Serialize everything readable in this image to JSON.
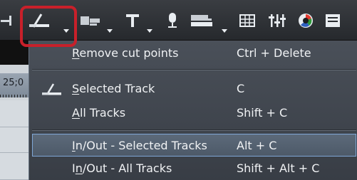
{
  "toolbar": {
    "items": [
      {
        "icon": "partial-icon"
      },
      {
        "icon": "add-cut-point-icon",
        "has_dropdown": true
      },
      {
        "icon": "video-layout-icon",
        "has_dropdown": true
      },
      {
        "icon": "title-icon",
        "has_dropdown": true
      },
      {
        "icon": "microphone-icon"
      },
      {
        "icon": "transfer-icon",
        "has_dropdown": true
      },
      {
        "icon": "grid-icon"
      },
      {
        "icon": "audio-mixer-icon"
      },
      {
        "icon": "color-correction-icon"
      },
      {
        "icon": "panel-icon"
      }
    ],
    "highlight_color": "#c8202a"
  },
  "timeline": {
    "timecode_fragment": "25;0"
  },
  "menu": {
    "items": [
      {
        "pre": "",
        "mnemonic": "R",
        "post": "emove cut points",
        "shortcut": "Ctrl + Delete",
        "icon": ""
      },
      {
        "pre": "",
        "mnemonic": "S",
        "post": "elected Track",
        "shortcut": "C",
        "icon": "add-cut-point-icon"
      },
      {
        "pre": "",
        "mnemonic": "A",
        "post": "ll Tracks",
        "shortcut": "Shift + C",
        "icon": ""
      },
      {
        "pre": "",
        "mnemonic": "I",
        "post": "n/Out - Selected Tracks",
        "shortcut": "Alt + C",
        "icon": "",
        "highlighted": true
      },
      {
        "pre": "I",
        "mnemonic": "n",
        "post": "/Out - All Tracks",
        "shortcut": "Shift + Alt + C",
        "icon": ""
      }
    ]
  },
  "colors": {
    "menu_bg": "#3f444c",
    "menu_text": "#f0f2f4",
    "highlight_border": "#7fa7d6",
    "toolbar_bg": "#2f3236"
  }
}
